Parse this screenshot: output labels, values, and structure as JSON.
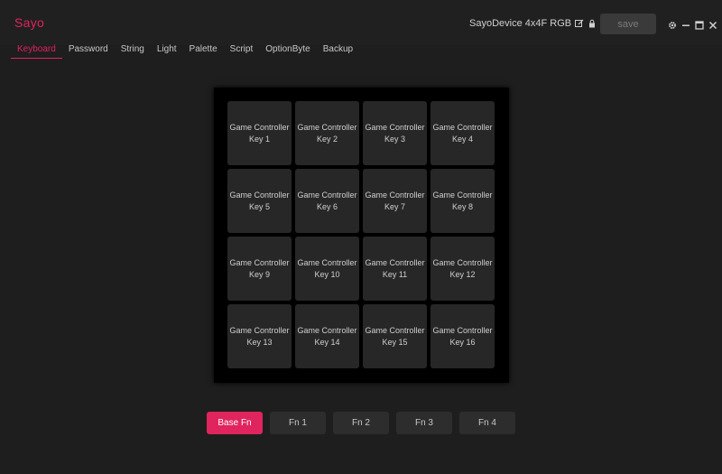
{
  "app": {
    "title": "Sayo",
    "accent": "#e0245e"
  },
  "header": {
    "device_name": "SayoDevice 4x4F RGB",
    "save_label": "save",
    "icons": [
      "edit-icon",
      "lock-icon",
      "menu-icon",
      "gear-icon",
      "minimize-icon",
      "maximize-icon",
      "close-icon"
    ]
  },
  "tabs": [
    {
      "label": "Keyboard",
      "active": true
    },
    {
      "label": "Password"
    },
    {
      "label": "String"
    },
    {
      "label": "Light"
    },
    {
      "label": "Palette"
    },
    {
      "label": "Script"
    },
    {
      "label": "OptionByte"
    },
    {
      "label": "Backup"
    }
  ],
  "keys": [
    {
      "line1": "Game Controller",
      "line2": "Key 1"
    },
    {
      "line1": "Game Controller",
      "line2": "Key 2"
    },
    {
      "line1": "Game Controller",
      "line2": "Key 3"
    },
    {
      "line1": "Game Controller",
      "line2": "Key 4"
    },
    {
      "line1": "Game Controller",
      "line2": "Key 5"
    },
    {
      "line1": "Game Controller",
      "line2": "Key 6"
    },
    {
      "line1": "Game Controller",
      "line2": "Key 7"
    },
    {
      "line1": "Game Controller",
      "line2": "Key 8"
    },
    {
      "line1": "Game Controller",
      "line2": "Key 9"
    },
    {
      "line1": "Game Controller",
      "line2": "Key 10"
    },
    {
      "line1": "Game Controller",
      "line2": "Key 11"
    },
    {
      "line1": "Game Controller",
      "line2": "Key 12"
    },
    {
      "line1": "Game Controller",
      "line2": "Key 13"
    },
    {
      "line1": "Game Controller",
      "line2": "Key 14"
    },
    {
      "line1": "Game Controller",
      "line2": "Key 15"
    },
    {
      "line1": "Game Controller",
      "line2": "Key 16"
    }
  ],
  "fn_layers": [
    {
      "label": "Base Fn",
      "active": true
    },
    {
      "label": "Fn 1"
    },
    {
      "label": "Fn 2"
    },
    {
      "label": "Fn 3"
    },
    {
      "label": "Fn 4"
    }
  ]
}
